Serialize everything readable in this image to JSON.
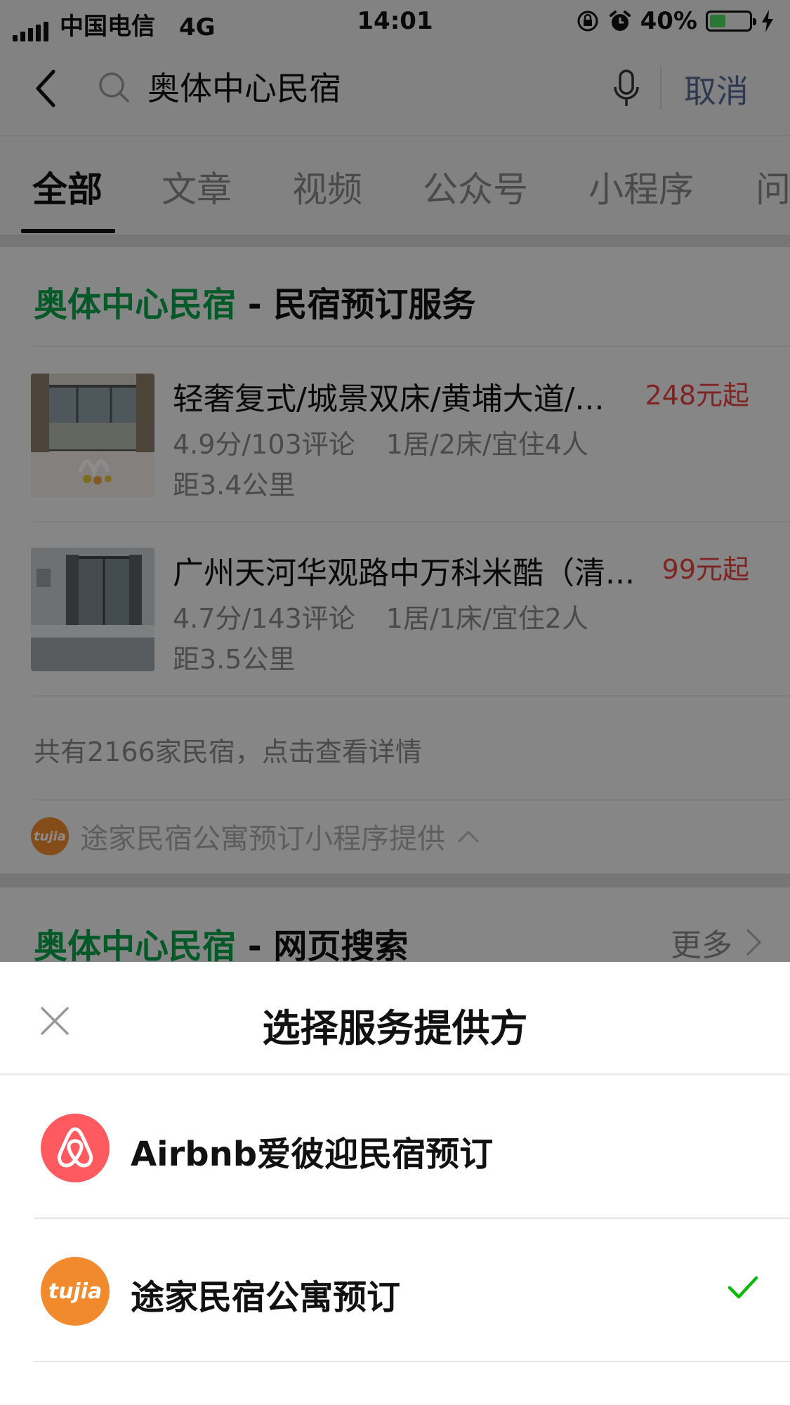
{
  "status_bar": {
    "carrier": "中国电信",
    "network": "4G",
    "time": "14:01",
    "battery": "40%",
    "battery_level": 0.4
  },
  "search": {
    "query": "奥体中心民宿",
    "cancel_label": "取消"
  },
  "tabs": [
    {
      "label": "全部",
      "active": true
    },
    {
      "label": "文章"
    },
    {
      "label": "视频"
    },
    {
      "label": "公众号"
    },
    {
      "label": "小程序"
    },
    {
      "label": "问"
    }
  ],
  "section1": {
    "title_highlight": "奥体中心民宿",
    "title_rest": " - 民宿预订服务",
    "listings": [
      {
        "title": "轻奢复式/城景双床/黄埔大道/...",
        "price": "248元起",
        "rating": "4.9分/103评论",
        "rooms": "1居/2床/宜住4人",
        "distance": "距3.4公里"
      },
      {
        "title": "广州天河华观路中万科米酷（清...",
        "price": "99元起",
        "rating": "4.7分/143评论",
        "rooms": "1居/1床/宜住2人",
        "distance": "距3.5公里"
      }
    ],
    "total_text": "共有2166家民宿，点击查看详情",
    "provider_text": "途家民宿公寓预订小程序提供",
    "provider_logo_text": "tujia"
  },
  "section2": {
    "title_highlight": "奥体中心民宿",
    "title_rest": " - 网页搜索",
    "more_label": "更多"
  },
  "sheet": {
    "title": "选择服务提供方",
    "options": [
      {
        "label": "Airbnb爱彼迎民宿预订",
        "selected": false
      },
      {
        "label": "途家民宿公寓预订",
        "selected": true,
        "logo_text": "tujia"
      }
    ]
  },
  "colors": {
    "highlight_green": "#07a248",
    "price_red": "#e64340",
    "link_blue": "#576b95",
    "airbnb_pink": "#ff5a5f",
    "tujia_orange": "#f08a2c",
    "check_green": "#09bb07"
  }
}
